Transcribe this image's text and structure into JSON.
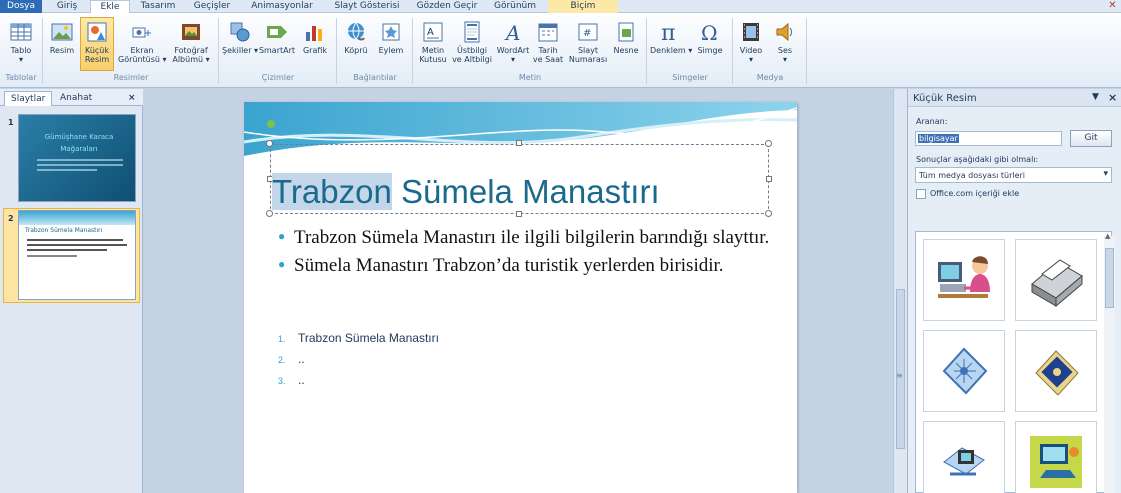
{
  "tabs": [
    "Dosya",
    "Giriş",
    "Ekle",
    "Tasarım",
    "Geçişler",
    "Animasyonlar",
    "Slayt Gösterisi",
    "Gözden Geçir",
    "Görünüm",
    "Biçim"
  ],
  "ribbon": {
    "buttons": {
      "tablo": "Tablo",
      "resim": "Resim",
      "kucuk_resim_1": "Küçük",
      "kucuk_resim_2": "Resim",
      "ekran_1": "Ekran",
      "ekran_2": "Görüntüsü",
      "album_1": "Fotoğraf",
      "album_2": "Albümü",
      "sekiller": "Şekiller",
      "smartart": "SmartArt",
      "grafik": "Grafik",
      "kopru": "Köprü",
      "eylem": "Eylem",
      "metin_1": "Metin",
      "metin_2": "Kutusu",
      "ustbilgi_1": "Üstbilgi",
      "ustbilgi_2": "ve Altbilgi",
      "wordart": "WordArt",
      "tarih_1": "Tarih",
      "tarih_2": "ve Saat",
      "slayt_1": "Slayt",
      "slayt_2": "Numarası",
      "nesne": "Nesne",
      "denklem": "Denklem",
      "simge": "Simge",
      "video": "Video",
      "ses": "Ses"
    },
    "groups": {
      "tablolar": "Tablolar",
      "resimler": "Resimler",
      "cizimler": "Çizimler",
      "baglantilar": "Bağlantılar",
      "metin": "Metin",
      "simgeler": "Simgeler",
      "medya": "Medya"
    }
  },
  "left_pane": {
    "tab_slides": "Slaytlar",
    "tab_outline": "Anahat",
    "close": "×",
    "slide1_num": "1",
    "slide1_title_1": "Gümüşhane Karaca",
    "slide1_title_2": "Mağaraları",
    "slide2_num": "2",
    "slide2_title": "Trabzon Sümela Manastırı"
  },
  "slide": {
    "title_highlight": "Trabzon",
    "title_rest": " Sümela Manastırı",
    "bullet1": "Trabzon Sümela Manastırı ile ilgili bilgilerin barındığı slayttır.",
    "bullet2": "Sümela Manastırı Trabzon’da turistik yerlerden birisidir.",
    "num_items": [
      {
        "n": "1.",
        "text": "Trabzon Sümela Manastırı"
      },
      {
        "n": "2.",
        "text": ".."
      },
      {
        "n": "3.",
        "text": ".."
      }
    ]
  },
  "clipart": {
    "title": "Küçük Resim",
    "search_label": "Aranan:",
    "search_value": "bilgisayar",
    "go": "Git",
    "results_label": "Sonuçlar aşağıdaki gibi olmalı:",
    "results_value": "Tüm medya dosyası türleri",
    "office_check": "Office.com içeriği ekle"
  },
  "colors": {
    "file_tab": "#2e6bb5",
    "title": "#1a6a8c",
    "bullet": "#2aa6c4",
    "selection": "#f9cf6b"
  }
}
